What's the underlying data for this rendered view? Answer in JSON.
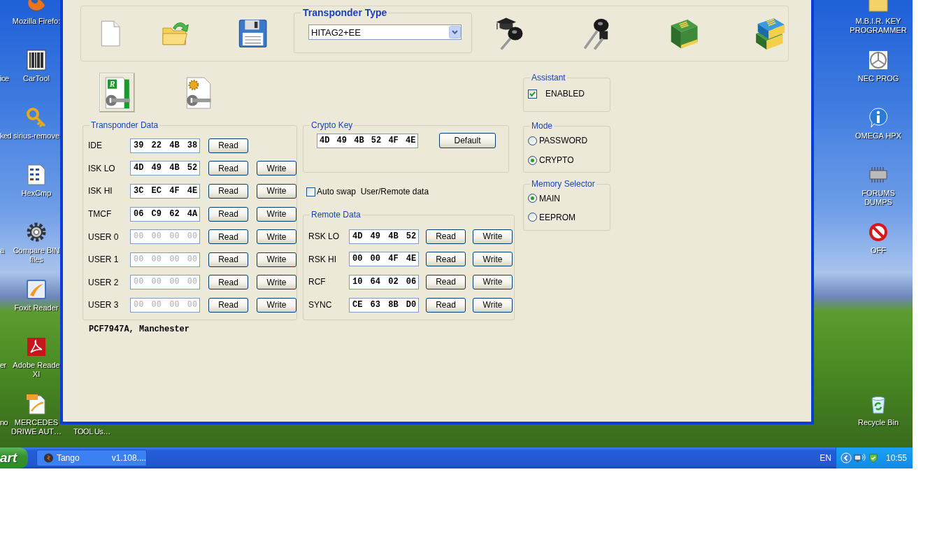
{
  "desktop": {
    "left_icons": [
      {
        "kind": "firefox",
        "label": "Mozilla Firefo:"
      },
      {
        "kind": "barcode",
        "label": "CarTool"
      },
      {
        "kind": "key",
        "label": "sirius-remove"
      },
      {
        "kind": "hexdoc",
        "label": "HexCmp"
      },
      {
        "kind": "gear",
        "label": "Compare BIN\nfiles"
      },
      {
        "kind": "foxit",
        "label": "Foxit Reader"
      },
      {
        "kind": "pdf",
        "label": "Adobe Reade\nXI"
      },
      {
        "kind": "pdfdoc",
        "label": "MERCEDES\nDRIWE AUT…"
      }
    ],
    "edge_labels": [
      "ice",
      "ked",
      "a",
      "er",
      "no"
    ],
    "hidden_icon_label": "TOOL Us…",
    "right_icons": [
      {
        "kind": "folder",
        "label": "M.B.I.R. KEY\nPROGRAMMER"
      },
      {
        "kind": "star",
        "label": "NEC PROG"
      },
      {
        "kind": "info",
        "label": "OMEGA HPX"
      },
      {
        "kind": "chip",
        "label": "FORUMS\nDUMPS"
      },
      {
        "kind": "nosign",
        "label": "OFF"
      },
      {
        "kind": "recycle",
        "label": "Recycle Bin"
      }
    ]
  },
  "window": {
    "toolbar": {
      "icons_before": [
        {
          "kind": "blankdoc"
        },
        {
          "kind": "folderarrow"
        },
        {
          "kind": "floppy"
        }
      ],
      "transponder_type": {
        "legend": "Transponder Type",
        "value": "HITAG2+EE"
      },
      "icons_after": [
        {
          "kind": "keycap"
        },
        {
          "kind": "keys"
        },
        {
          "kind": "book"
        },
        {
          "kind": "books"
        }
      ]
    },
    "action_icons": [
      {
        "kind": "dockey",
        "badge": "R",
        "selected": true
      },
      {
        "kind": "docgear",
        "selected": false
      }
    ],
    "transponder_data": {
      "legend": "Transponder Data",
      "rows": [
        {
          "label": "IDE",
          "value": "39 22 4B 38",
          "disabled": false,
          "buttons": [
            "Read"
          ]
        },
        {
          "label": "ISK LO",
          "value": "4D 49 4B 52",
          "disabled": false,
          "buttons": [
            "Read",
            "Write"
          ]
        },
        {
          "label": "ISK HI",
          "value": "3C EC 4F 4E",
          "disabled": false,
          "buttons": [
            "Read",
            "Write"
          ]
        },
        {
          "label": "TMCF",
          "value": "06 C9 62 4A",
          "disabled": false,
          "buttons": [
            "Read",
            "Write"
          ]
        },
        {
          "label": "USER 0",
          "value": "00 00 00 00",
          "disabled": true,
          "buttons": [
            "Read",
            "Write"
          ]
        },
        {
          "label": "USER 1",
          "value": "00 00 00 00",
          "disabled": true,
          "buttons": [
            "Read",
            "Write"
          ]
        },
        {
          "label": "USER 2",
          "value": "00 00 00 00",
          "disabled": true,
          "buttons": [
            "Read",
            "Write"
          ]
        },
        {
          "label": "USER 3",
          "value": "00 00 00 00",
          "disabled": true,
          "buttons": [
            "Read",
            "Write"
          ]
        }
      ]
    },
    "crypto_key": {
      "legend": "Crypto Key",
      "value": "4D 49 4B 52 4F 4E",
      "button": "Default"
    },
    "auto_swap": {
      "label": "Auto swap  User/Remote data",
      "checked": false
    },
    "remote_data": {
      "legend": "Remote Data",
      "rows": [
        {
          "label": "RSK LO",
          "value": "4D 49 4B 52",
          "disabled": false,
          "buttons": [
            "Read",
            "Write"
          ]
        },
        {
          "label": "RSK HI",
          "value": "00 00 4F 4E",
          "disabled": false,
          "buttons": [
            "Read",
            "Write"
          ]
        },
        {
          "label": "RCF",
          "value": "10 64 02 06",
          "disabled": false,
          "buttons": [
            "Read",
            "Write"
          ]
        },
        {
          "label": "SYNC",
          "value": "CE 63 8B D0",
          "disabled": false,
          "buttons": [
            "Read",
            "Write"
          ]
        }
      ]
    },
    "status_text": "PCF7947A, Manchester",
    "assistant": {
      "legend": "Assistant",
      "label": "ENABLED",
      "checked": true
    },
    "mode": {
      "legend": "Mode",
      "options": [
        {
          "label": "PASSWORD",
          "selected": false
        },
        {
          "label": "CRYPTO",
          "selected": true
        }
      ]
    },
    "memory_selector": {
      "legend": "Memory Selector",
      "options": [
        {
          "label": "MAIN",
          "selected": true
        },
        {
          "label": "EEPROM",
          "selected": false
        }
      ]
    }
  },
  "taskbar": {
    "start_label": "art",
    "tasks": [
      {
        "title": "Tango",
        "subtitle": "v1.108...."
      }
    ],
    "language": "EN",
    "clock": "10:55"
  }
}
